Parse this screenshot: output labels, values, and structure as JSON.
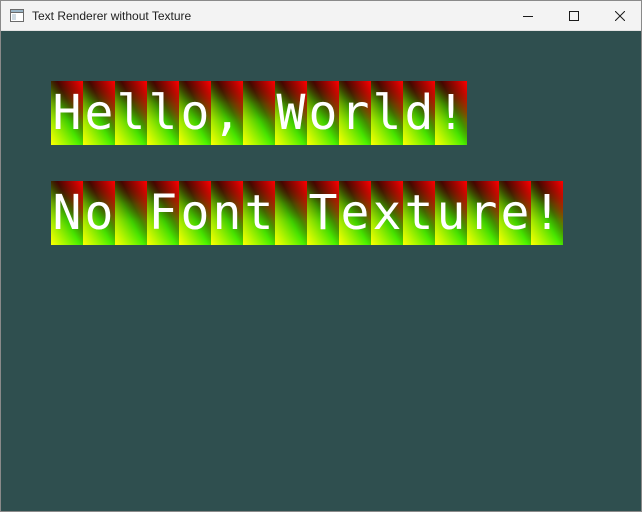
{
  "window": {
    "title": "Text Renderer without Texture",
    "background_color": "#2f4f4f",
    "icons": {
      "app": "window-app-icon",
      "minimize": "minimize-icon",
      "maximize": "maximize-icon",
      "close": "close-icon"
    }
  },
  "rendered_text": {
    "lines": [
      "Hello, World!",
      "No Font Texture!"
    ],
    "glyph_color": "#ffffff",
    "cell_gradient_colors": [
      "#ff0000",
      "#00ff00",
      "#ffff00",
      "#000000"
    ]
  }
}
